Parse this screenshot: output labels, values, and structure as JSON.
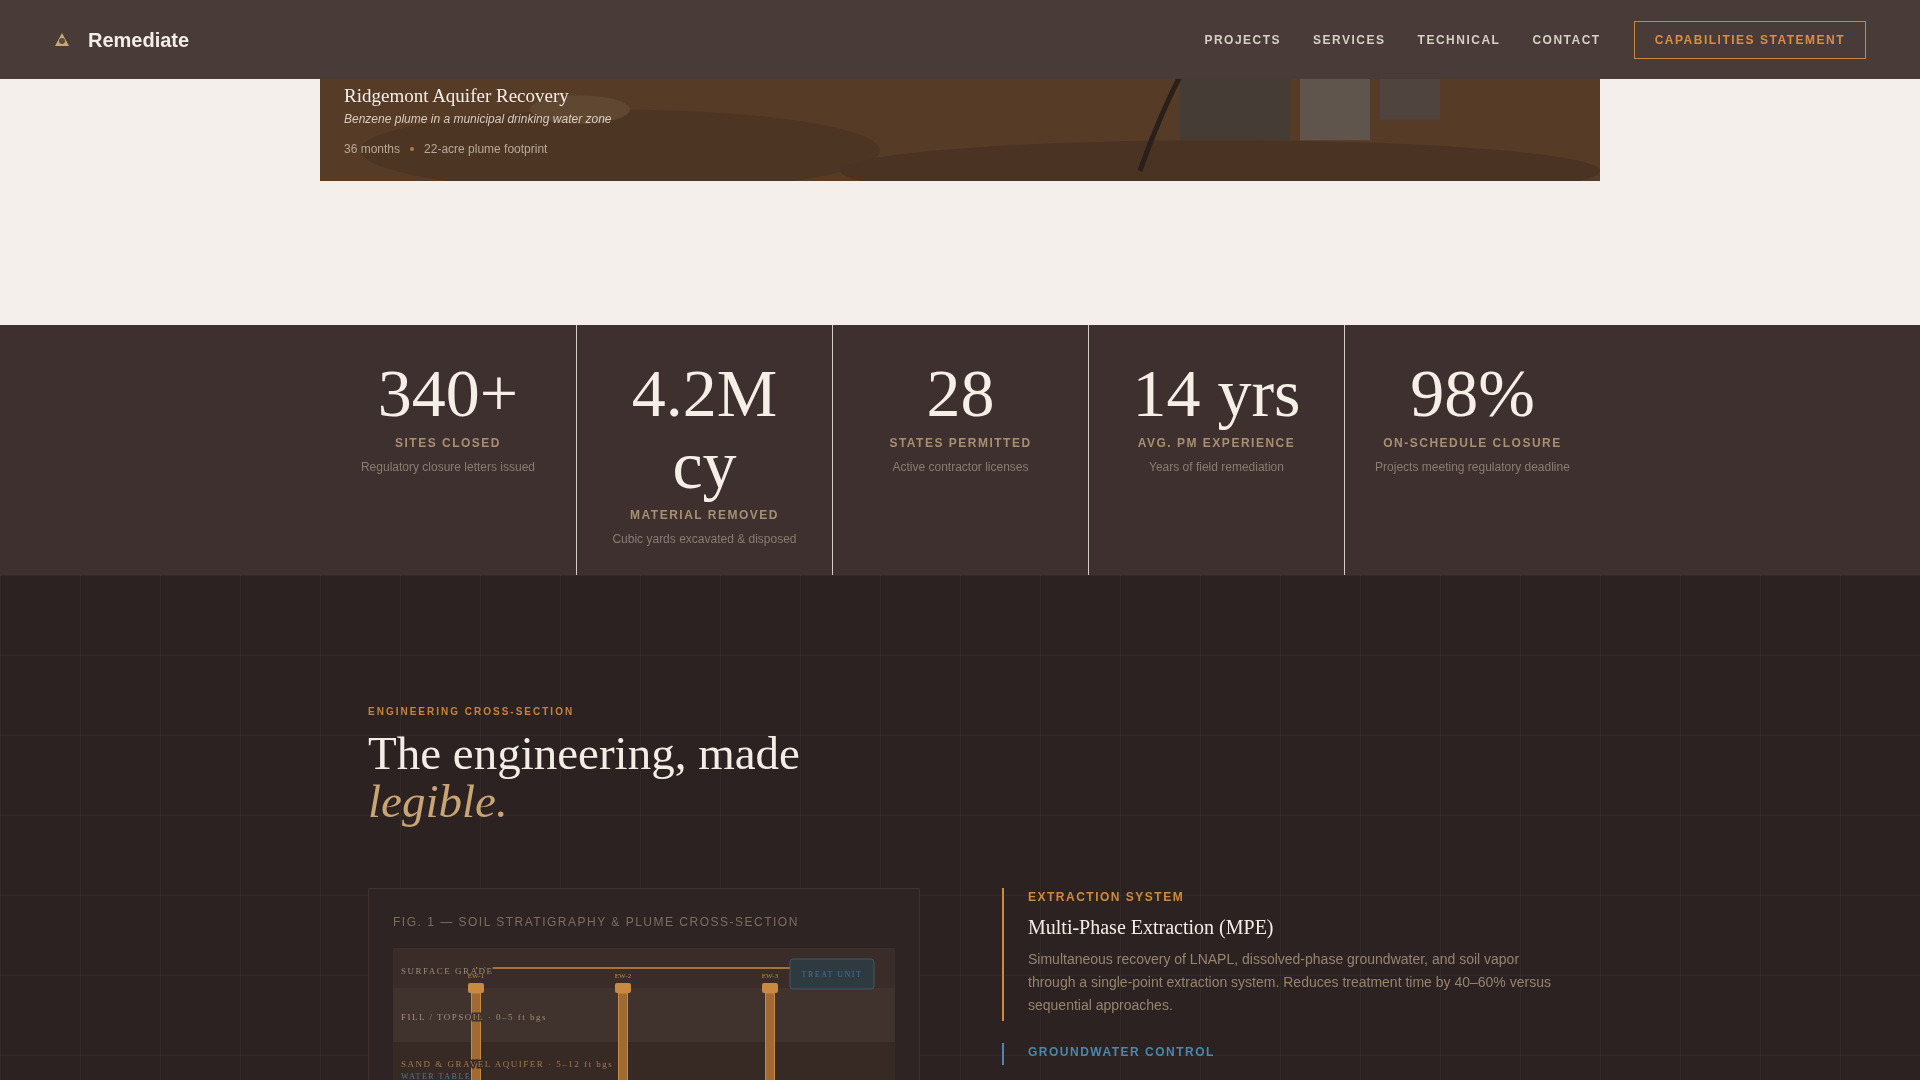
{
  "nav": {
    "brand": "Remediate",
    "links": [
      "PROJECTS",
      "SERVICES",
      "TECHNICAL",
      "CONTACT"
    ],
    "cta": "CAPABILITIES STATEMENT"
  },
  "project_card": {
    "kind": "picture",
    "title": "Ridgemont Aquifer Recovery",
    "subtitle": "Benzene plume in a municipal drinking water zone",
    "meta": [
      "36 months",
      "22-acre plume footprint"
    ]
  },
  "stats": [
    {
      "value": "340+",
      "label": "SITES CLOSED",
      "note": "Regulatory closure letters issued"
    },
    {
      "value": "4.2M cy",
      "label": "MATERIAL REMOVED",
      "note": "Cubic yards excavated & disposed"
    },
    {
      "value": "28",
      "label": "STATES PERMITTED",
      "note": "Active contractor licenses"
    },
    {
      "value": "14 yrs",
      "label": "AVG. PM EXPERIENCE",
      "note": "Years of field remediation"
    },
    {
      "value": "98%",
      "label": "ON-SCHEDULE CLOSURE",
      "note": "Projects meeting regulatory deadline"
    }
  ],
  "section": {
    "eyebrow": "ENGINEERING CROSS-SECTION",
    "heading": "The engineering, made",
    "heading_emphasis": "legible."
  },
  "figure": {
    "caption": "FIG. 1 — SOIL STRATIGRAPHY & PLUME CROSS-SECTION",
    "layers": [
      {
        "label": "SURFACE GRADE"
      },
      {
        "label": "FILL / TOPSOIL · 0–5 ft bgs"
      },
      {
        "label": "SAND & GRAVEL AQUIFER · 5–12 ft bgs"
      }
    ],
    "wells": [
      "EW-1",
      "EW-2",
      "EW-3"
    ],
    "treatment_unit": "TREAT UNIT",
    "water_table": "WATER TABLE"
  },
  "systems": [
    {
      "eyebrow": "EXTRACTION SYSTEM",
      "title": "Multi-Phase Extraction (MPE)",
      "description": "Simultaneous recovery of LNAPL, dissolved-phase groundwater, and soil vapor through a single-point extraction system. Reduces treatment time by 40–60% versus sequential approaches.",
      "color": "#d08a3c"
    },
    {
      "eyebrow": "GROUNDWATER CONTROL",
      "color": "#4a88ad"
    }
  ]
}
